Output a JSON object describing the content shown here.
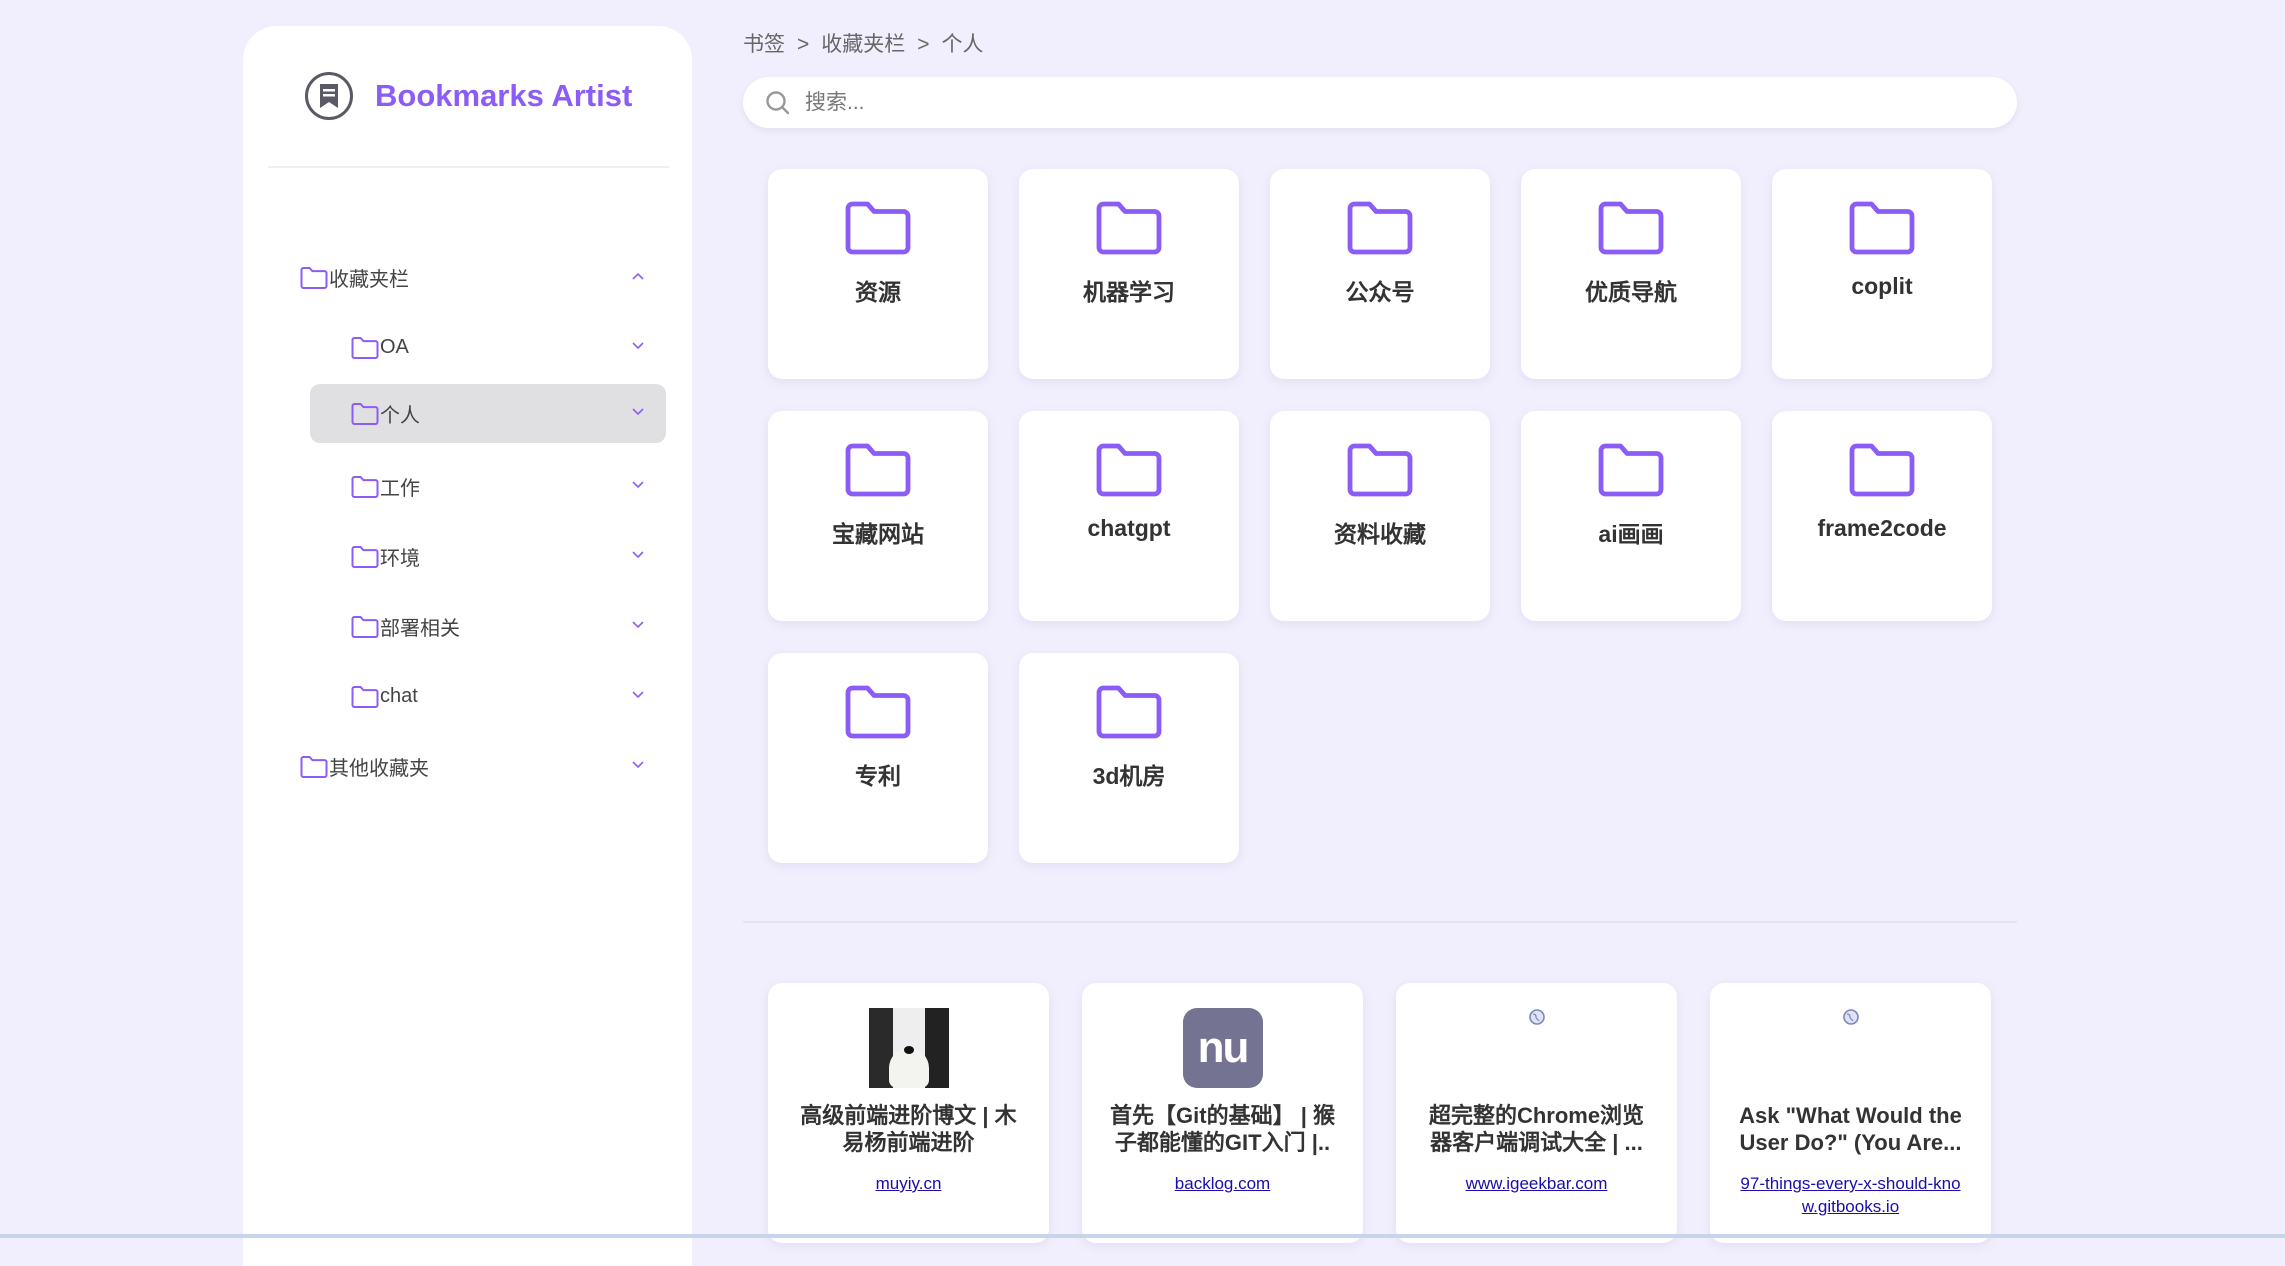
{
  "app": {
    "title": "Bookmarks Artist",
    "accent": "#8b5cf6"
  },
  "breadcrumb": [
    "书签",
    "收藏夹栏",
    "个人"
  ],
  "breadcrumb_sep": ">",
  "search": {
    "placeholder": "搜索...",
    "value": ""
  },
  "sidebar": {
    "items": [
      {
        "label": "收藏夹栏",
        "level": 0,
        "expanded": true,
        "selected": false
      },
      {
        "label": "OA",
        "level": 1,
        "expanded": false,
        "selected": false
      },
      {
        "label": "个人",
        "level": 1,
        "expanded": false,
        "selected": true
      },
      {
        "label": "工作",
        "level": 1,
        "expanded": false,
        "selected": false
      },
      {
        "label": "环境",
        "level": 1,
        "expanded": false,
        "selected": false
      },
      {
        "label": "部署相关",
        "level": 1,
        "expanded": false,
        "selected": false
      },
      {
        "label": "chat",
        "level": 1,
        "expanded": false,
        "selected": false
      },
      {
        "label": "其他收藏夹",
        "level": 0,
        "expanded": false,
        "selected": false
      }
    ]
  },
  "folders": [
    "资源",
    "机器学习",
    "公众号",
    "优质导航",
    "coplit",
    "宝藏网站",
    "chatgpt",
    "资料收藏",
    "ai画画",
    "frame2code",
    "专利",
    "3d机房"
  ],
  "bookmarks": [
    {
      "title": "高级前端进阶博文 | 木易杨前端进阶",
      "domain": "muyiy.cn",
      "icon": "dog-photo"
    },
    {
      "title": "首先【Git的基础】 | 猴子都能懂的GIT入门 |..",
      "domain": "backlog.com",
      "icon": "nu-logo"
    },
    {
      "title": "超完整的Chrome浏览器客户端调试大全 | ...",
      "domain": "www.igeekbar.com",
      "icon": "globe-icon"
    },
    {
      "title": "Ask \"What Would the User Do?\" (You Are...",
      "domain": "97-things-every-x-should-know.gitbooks.io",
      "icon": "globe-icon"
    }
  ]
}
